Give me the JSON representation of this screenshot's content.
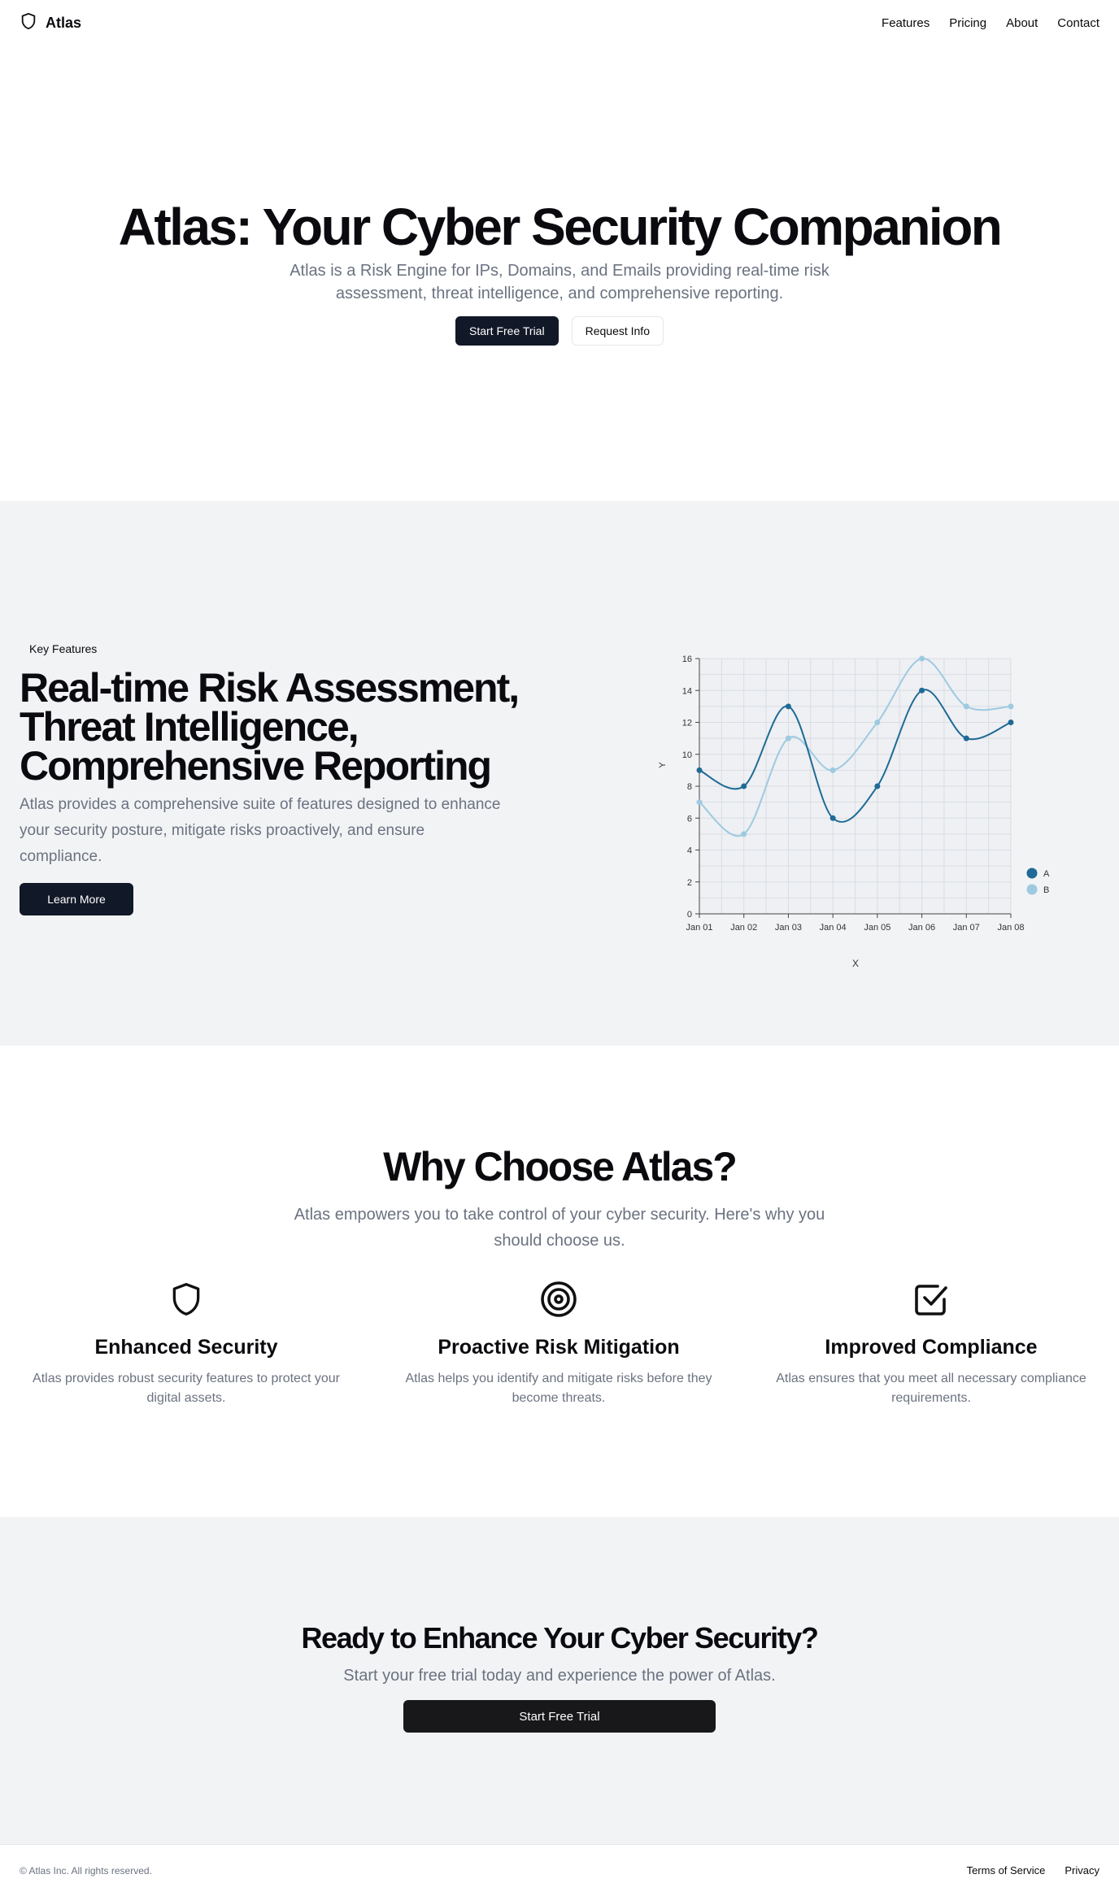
{
  "header": {
    "brand": "Atlas",
    "brand_icon": "shield-icon",
    "nav": [
      "Features",
      "Pricing",
      "About",
      "Contact"
    ]
  },
  "hero": {
    "title": "Atlas: Your Cyber Security Companion",
    "subtitle": "Atlas is a Risk Engine for IPs, Domains, and Emails providing real-time risk assessment, threat intelligence, and comprehensive reporting.",
    "primary_cta": "Start Free Trial",
    "secondary_cta": "Request Info"
  },
  "features": {
    "badge": "Key Features",
    "title": "Real-time Risk Assessment, Threat Intelligence, Comprehensive Reporting",
    "description": "Atlas provides a comprehensive suite of features designed to enhance your security posture, mitigate risks proactively, and ensure compliance.",
    "cta": "Learn More"
  },
  "chart_data": {
    "type": "line",
    "categories": [
      "Jan 01",
      "Jan 02",
      "Jan 03",
      "Jan 04",
      "Jan 05",
      "Jan 06",
      "Jan 07",
      "Jan 08"
    ],
    "series": [
      {
        "name": "A",
        "values": [
          9,
          8,
          13,
          6,
          8,
          14,
          11,
          12
        ],
        "color": "#1f6a96"
      },
      {
        "name": "B",
        "values": [
          7,
          5,
          11,
          9,
          12,
          16,
          13,
          13
        ],
        "color": "#9ecae1"
      }
    ],
    "xlabel": "X",
    "ylabel": "Y",
    "ylim": [
      0,
      16
    ],
    "yticks": [
      0,
      2,
      4,
      6,
      8,
      10,
      12,
      14,
      16
    ],
    "grid": true,
    "legend": "bottom-right"
  },
  "why": {
    "title": "Why Choose Atlas?",
    "lead": "Atlas empowers you to take control of your cyber security. Here's why you should choose us.",
    "cards": [
      {
        "icon": "shield-icon",
        "title": "Enhanced Security",
        "text": "Atlas provides robust security features to protect your digital assets."
      },
      {
        "icon": "target-icon",
        "title": "Proactive Risk Mitigation",
        "text": "Atlas helps you identify and mitigate risks before they become threats."
      },
      {
        "icon": "checkbox-icon",
        "title": "Improved Compliance",
        "text": "Atlas ensures that you meet all necessary compliance requirements."
      }
    ]
  },
  "cta": {
    "title": "Ready to Enhance Your Cyber Security?",
    "text": "Start your free trial today and experience the power of Atlas.",
    "button": "Start Free Trial"
  },
  "footer": {
    "copyright": "© Atlas Inc. All rights reserved.",
    "links": [
      "Terms of Service",
      "Privacy"
    ]
  }
}
